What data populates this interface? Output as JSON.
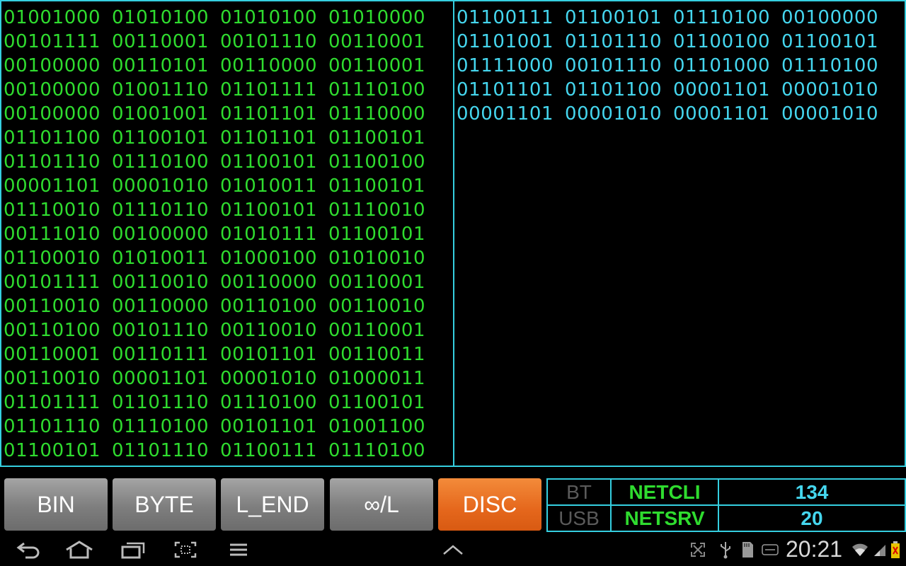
{
  "left_pane": {
    "rows": [
      [
        "01001000",
        "01010100",
        "01010100",
        "01010000"
      ],
      [
        "00101111",
        "00110001",
        "00101110",
        "00110001"
      ],
      [
        "00100000",
        "00110101",
        "00110000",
        "00110001"
      ],
      [
        "00100000",
        "01001110",
        "01101111",
        "01110100"
      ],
      [
        "00100000",
        "01001001",
        "01101101",
        "01110000"
      ],
      [
        "01101100",
        "01100101",
        "01101101",
        "01100101"
      ],
      [
        "01101110",
        "01110100",
        "01100101",
        "01100100"
      ],
      [
        "00001101",
        "00001010",
        "01010011",
        "01100101"
      ],
      [
        "01110010",
        "01110110",
        "01100101",
        "01110010"
      ],
      [
        "00111010",
        "00100000",
        "01010111",
        "01100101"
      ],
      [
        "01100010",
        "01010011",
        "01000100",
        "01010010"
      ],
      [
        "00101111",
        "00110010",
        "00110000",
        "00110001"
      ],
      [
        "00110010",
        "00110000",
        "00110100",
        "00110010"
      ],
      [
        "00110100",
        "00101110",
        "00110010",
        "00110001"
      ],
      [
        "00110001",
        "00110111",
        "00101101",
        "00110011"
      ],
      [
        "00110010",
        "00001101",
        "00001010",
        "01000011"
      ],
      [
        "01101111",
        "01101110",
        "01110100",
        "01100101"
      ],
      [
        "01101110",
        "01110100",
        "00101101",
        "01001100"
      ],
      [
        "01100101",
        "01101110",
        "01100111",
        "01110100"
      ]
    ]
  },
  "right_pane": {
    "rows": [
      [
        "01100111",
        "01100101",
        "01110100",
        "00100000"
      ],
      [
        "01101001",
        "01101110",
        "01100100",
        "01100101"
      ],
      [
        "01111000",
        "00101110",
        "01101000",
        "01110100"
      ],
      [
        "01101101",
        "01101100",
        "00001101",
        "00001010"
      ],
      [
        "00001101",
        "00001010",
        "00001101",
        "00001010"
      ]
    ]
  },
  "toolbar": {
    "bin": "BIN",
    "byte": "BYTE",
    "l_end": "L_END",
    "inf_l": "∞/L",
    "disc": "DISC"
  },
  "status": {
    "bt": "BT",
    "usb": "USB",
    "netcli": "NETCLI",
    "netsrv": "NETSRV",
    "netcli_count": "134",
    "netsrv_count": "20"
  },
  "system_bar": {
    "clock": "20:21"
  },
  "colors": {
    "left_text": "#2fdc2f",
    "right_text": "#45d6ee",
    "border": "#35cfe0",
    "disc_button": "#e5671c",
    "inactive_label": "#5a5a5a",
    "active_label": "#2fdc2f",
    "count_label": "#45d6ee"
  }
}
